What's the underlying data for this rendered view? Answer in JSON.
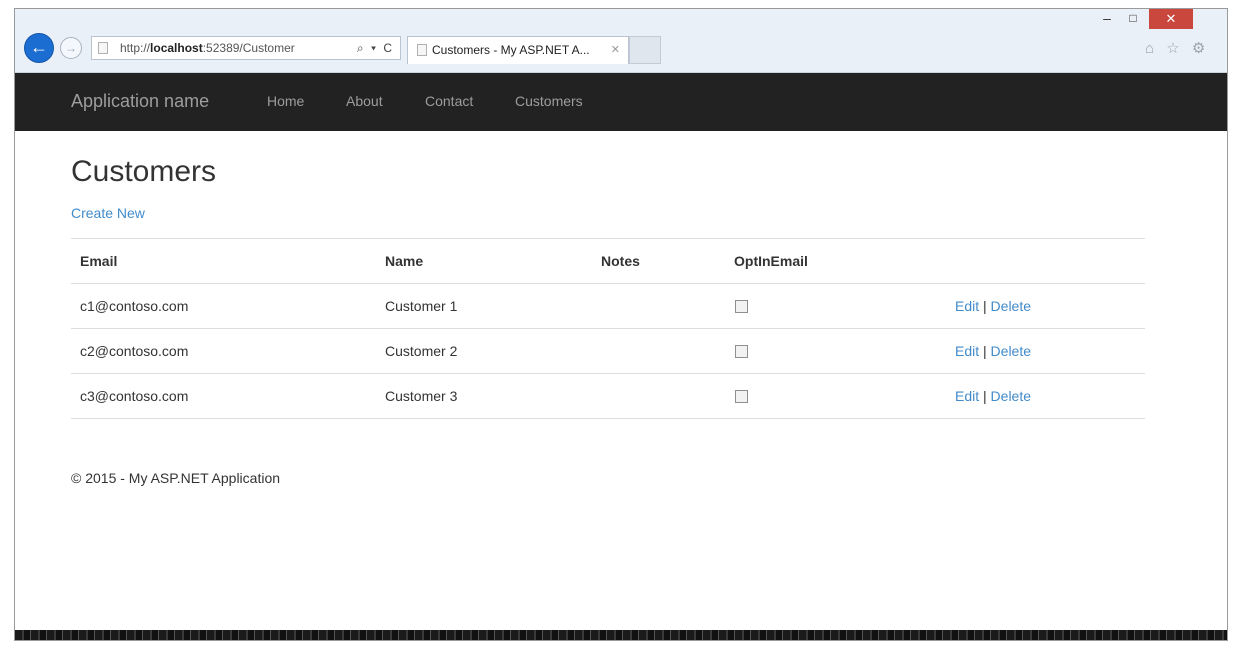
{
  "browser": {
    "url_prefix": "http://",
    "url_host": "localhost",
    "url_rest": ":52389/Customer",
    "address_icons": "⌕ ▾ C",
    "tab_title": "Customers - My ASP.NET A...",
    "tab_close": "✕",
    "window_minimize": "–",
    "window_maximize": "□",
    "window_close": "✕",
    "toolbar_icons": "⌂ ☆ ⚙"
  },
  "navbar": {
    "brand": "Application name",
    "links": [
      "Home",
      "About",
      "Contact",
      "Customers"
    ]
  },
  "page": {
    "title": "Customers",
    "create_link": "Create New"
  },
  "table": {
    "headers": {
      "email": "Email",
      "name": "Name",
      "notes": "Notes",
      "opt_in": "OptInEmail"
    },
    "rows": [
      {
        "email": "c1@contoso.com",
        "name": "Customer 1",
        "notes": "",
        "opt_in": false,
        "edit": "Edit",
        "sep": "|",
        "delete": "Delete"
      },
      {
        "email": "c2@contoso.com",
        "name": "Customer 2",
        "notes": "",
        "opt_in": false,
        "edit": "Edit",
        "sep": "|",
        "delete": "Delete"
      },
      {
        "email": "c3@contoso.com",
        "name": "Customer 3",
        "notes": "",
        "opt_in": false,
        "edit": "Edit",
        "sep": "|",
        "delete": "Delete"
      }
    ]
  },
  "footer": {
    "text": "© 2015 - My ASP.NET Application"
  },
  "colors": {
    "navbar_bg": "#222222",
    "nav_text": "#9d9d9d",
    "link": "#428bca",
    "back_button": "#1c6dd1",
    "close_button": "#c9473c"
  }
}
